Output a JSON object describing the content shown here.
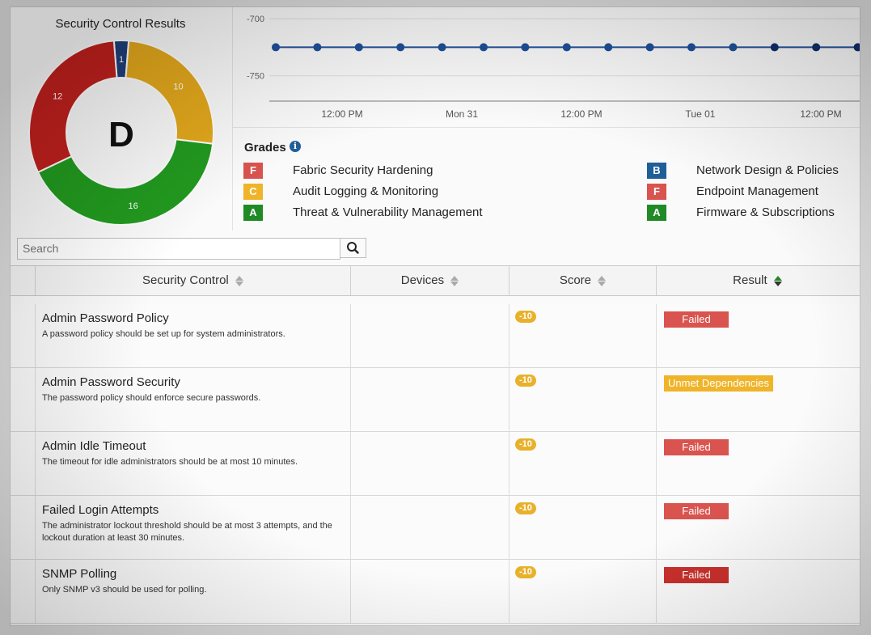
{
  "donut": {
    "title": "Security Control Results",
    "grade": "D",
    "segments": [
      {
        "label": "1",
        "value": 1,
        "color": "#1f3f7a"
      },
      {
        "label": "10",
        "value": 10,
        "color": "#e3a81c"
      },
      {
        "label": "16",
        "value": 16,
        "color": "#229a1f"
      },
      {
        "label": "12",
        "value": 12,
        "color": "#c0201d"
      }
    ]
  },
  "chart_data": {
    "type": "line",
    "y_ticks": [
      "-700",
      "-750"
    ],
    "x_ticks": [
      "12:00 PM",
      "Mon 31",
      "12:00 PM",
      "Tue 01",
      "12:00 PM"
    ],
    "ylim": [
      -775,
      -690
    ],
    "series": [
      {
        "color": "#1f4f9a",
        "values": [
          -725,
          -725,
          -725,
          -725,
          -725,
          -725,
          -725,
          -725,
          -725,
          -725,
          -725,
          -725,
          -725,
          -725,
          -725
        ]
      }
    ]
  },
  "grades": {
    "title": "Grades",
    "info_icon": "i",
    "left": [
      {
        "grade": "F",
        "label": "Fabric Security Hardening",
        "color": "#d9534f"
      },
      {
        "grade": "C",
        "label": "Audit Logging & Monitoring",
        "color": "#f0b42a"
      },
      {
        "grade": "A",
        "label": "Threat & Vulnerability Management",
        "color": "#1f8a26"
      }
    ],
    "right": [
      {
        "grade": "B",
        "label": "Network Design & Policies",
        "color": "#1f5f99"
      },
      {
        "grade": "F",
        "label": "Endpoint Management",
        "color": "#d9534f"
      },
      {
        "grade": "A",
        "label": "Firmware & Subscriptions",
        "color": "#1f8a26"
      }
    ]
  },
  "search": {
    "placeholder": "Search",
    "button_icon": "search-icon"
  },
  "table": {
    "columns": [
      "Security Control",
      "Devices",
      "Score",
      "Result"
    ],
    "rows": [
      {
        "title": "Admin Password Policy",
        "desc": "A password policy should be set up for system administrators.",
        "score": "-10",
        "result": "Failed",
        "result_type": "failed"
      },
      {
        "title": "Admin Password Security",
        "desc": "The password policy should enforce secure passwords.",
        "score": "-10",
        "result": "Unmet Dependencies",
        "result_type": "unmet"
      },
      {
        "title": "Admin Idle Timeout",
        "desc": "The timeout for idle administrators should be at most 10 minutes.",
        "score": "-10",
        "result": "Failed",
        "result_type": "failed"
      },
      {
        "title": "Failed Login Attempts",
        "desc": "The administrator lockout threshold should be at most 3 attempts, and the lockout duration at least 30 minutes.",
        "score": "-10",
        "result": "Failed",
        "result_type": "failed"
      },
      {
        "title": "SNMP Polling",
        "desc": "Only SNMP v3 should be used for polling.",
        "score": "-10",
        "result": "Failed",
        "result_type": "failed-dark"
      }
    ]
  }
}
